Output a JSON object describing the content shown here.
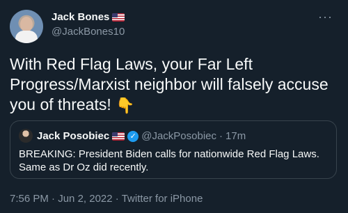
{
  "author": {
    "name": "Jack Bones",
    "handle": "@JackBones10"
  },
  "more_label": "···",
  "tweet": {
    "text": "With Red Flag Laws, your Far Left Progress/Marxist neighbor will falsely accuse you of threats!",
    "emoji": "👇"
  },
  "quoted": {
    "name": "Jack Posobiec",
    "verified_mark": "✓",
    "handle": "@JackPosobiec",
    "separator": "·",
    "time": "17m",
    "text": "BREAKING: President Biden calls for nationwide Red Flag Laws. Same as Dr Oz did recently."
  },
  "meta": {
    "time": "7:56 PM",
    "date": "Jun 2, 2022",
    "client": "Twitter for iPhone",
    "separator": "·"
  },
  "colors": {
    "background": "#15202b",
    "text": "#f7f9f9",
    "secondary": "#8b98a5",
    "border": "#38444d",
    "verified": "#1d9bf0"
  },
  "icons": [
    "us-flag-icon",
    "more-icon",
    "backhand-index-pointing-down-icon",
    "verified-badge-icon"
  ]
}
